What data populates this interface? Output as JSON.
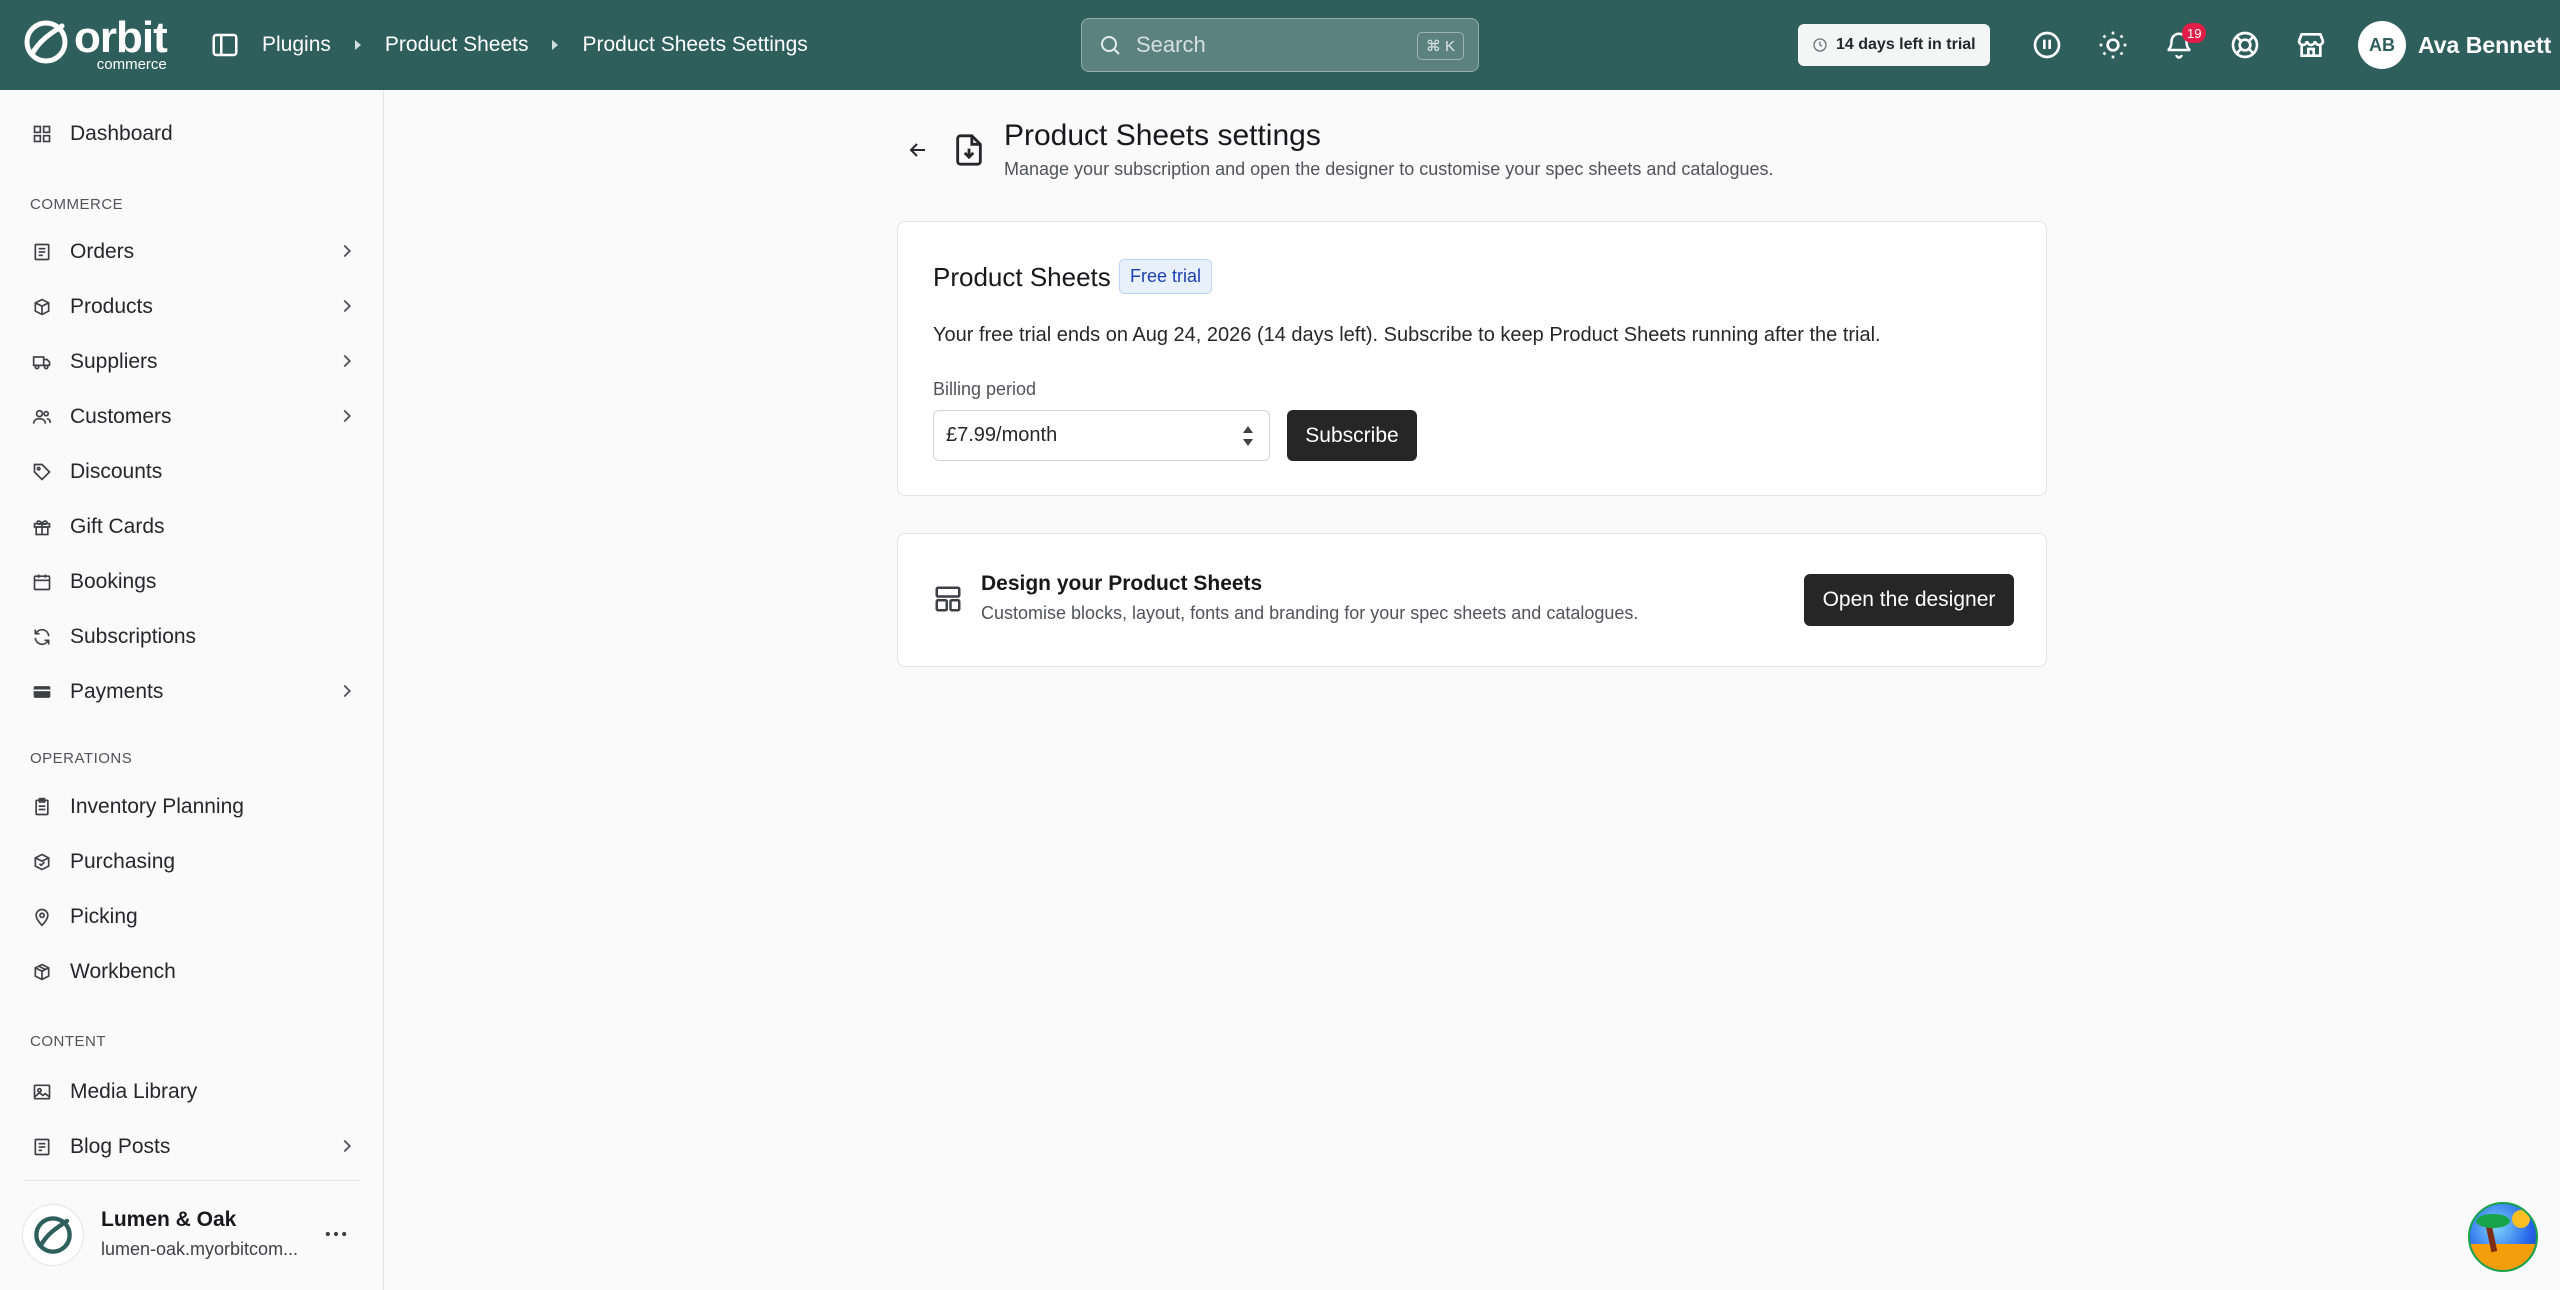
{
  "topbar": {
    "logo_text": "orbit",
    "logo_sub": "commerce",
    "breadcrumbs": [
      "Plugins",
      "Product Sheets",
      "Product Sheets Settings"
    ],
    "search_placeholder": "Search",
    "search_shortcut": "⌘ K",
    "trial_label": "14 days left in trial",
    "notifications_count": "19",
    "user_initials": "AB",
    "user_name": "Ava Bennett",
    "brand_color": "#2f5f5c"
  },
  "sidebar": {
    "dashboard": "Dashboard",
    "sections": {
      "commerce": "COMMERCE",
      "operations": "OPERATIONS",
      "content": "CONTENT"
    },
    "commerce_items": [
      {
        "label": "Orders",
        "icon": "orders-icon",
        "chevron": true
      },
      {
        "label": "Products",
        "icon": "box-icon",
        "chevron": true
      },
      {
        "label": "Suppliers",
        "icon": "truck-icon",
        "chevron": true
      },
      {
        "label": "Customers",
        "icon": "users-icon",
        "chevron": true
      },
      {
        "label": "Discounts",
        "icon": "tag-icon",
        "chevron": false
      },
      {
        "label": "Gift Cards",
        "icon": "gift-icon",
        "chevron": false
      },
      {
        "label": "Bookings",
        "icon": "calendar-icon",
        "chevron": false
      },
      {
        "label": "Subscriptions",
        "icon": "refresh-icon",
        "chevron": false
      },
      {
        "label": "Payments",
        "icon": "card-icon",
        "chevron": true
      }
    ],
    "operations_items": [
      {
        "label": "Inventory Planning",
        "icon": "clipboard-icon"
      },
      {
        "label": "Purchasing",
        "icon": "purchase-icon"
      },
      {
        "label": "Picking",
        "icon": "map-pin-icon"
      },
      {
        "label": "Workbench",
        "icon": "cube-icon"
      }
    ],
    "content_items": [
      {
        "label": "Media Library",
        "icon": "image-icon",
        "chevron": false
      },
      {
        "label": "Blog Posts",
        "icon": "blog-icon",
        "chevron": true
      }
    ],
    "store": {
      "name": "Lumen & Oak",
      "url": "lumen-oak.myorbitcom..."
    }
  },
  "main": {
    "title": "Product Sheets settings",
    "subtitle": "Manage your subscription and open the designer to customise your spec sheets and catalogues.",
    "subscription_card": {
      "title": "Product Sheets",
      "badge": "Free trial",
      "trial_text": "Your free trial ends on Aug 24, 2026 (14 days left). Subscribe to keep Product Sheets running after the trial.",
      "billing_label": "Billing period",
      "billing_value": "£7.99/month",
      "subscribe_label": "Subscribe"
    },
    "designer_card": {
      "title": "Design your Product Sheets",
      "subtitle": "Customise blocks, layout, fonts and branding for your spec sheets and catalogues.",
      "button_label": "Open the designer"
    }
  }
}
